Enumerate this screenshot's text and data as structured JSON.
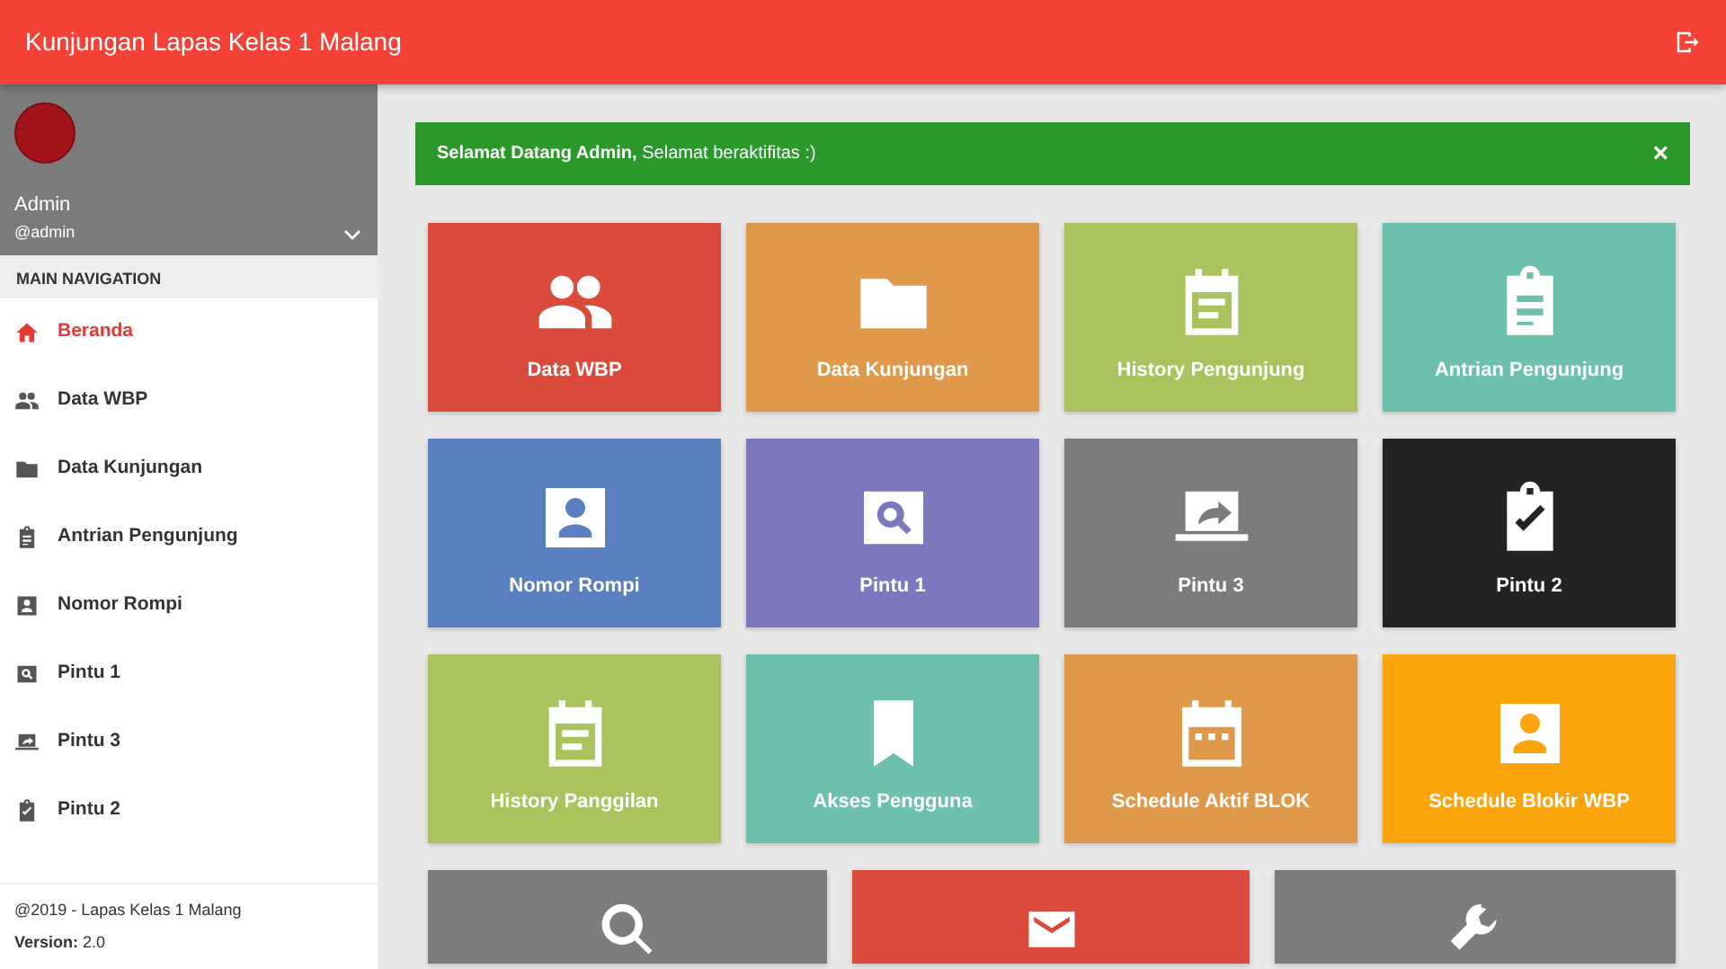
{
  "app_bar": {
    "title": "Kunjungan Lapas Kelas 1 Malang"
  },
  "user": {
    "name": "Admin",
    "handle": "@admin"
  },
  "sidebar": {
    "header": "MAIN NAVIGATION",
    "items": [
      {
        "label": "Beranda",
        "selected": true
      },
      {
        "label": "Data WBP",
        "selected": false
      },
      {
        "label": "Data Kunjungan",
        "selected": false
      },
      {
        "label": "Antrian Pengunjung",
        "selected": false
      },
      {
        "label": "Nomor Rompi",
        "selected": false
      },
      {
        "label": "Pintu 1",
        "selected": false
      },
      {
        "label": "Pintu 3",
        "selected": false
      },
      {
        "label": "Pintu 2",
        "selected": false
      }
    ],
    "copyright": "@2019 - Lapas Kelas 1 Malang",
    "version_label": "Version:",
    "version": "2.0"
  },
  "alert": {
    "bold": "Selamat Datang Admin,",
    "text": "Selamat beraktifitas :)",
    "close": "×"
  },
  "tiles": [
    {
      "label": "Data WBP",
      "color": "#da4b3c"
    },
    {
      "label": "Data Kunjungan",
      "color": "#e0994a"
    },
    {
      "label": "History Pengunjung",
      "color": "#aac35d"
    },
    {
      "label": "Antrian Pengunjung",
      "color": "#6dc0ae"
    },
    {
      "label": "Nomor Rompi",
      "color": "#5a80c1"
    },
    {
      "label": "Pintu 1",
      "color": "#7d77bd"
    },
    {
      "label": "Pintu 3",
      "color": "#7d7b7e"
    },
    {
      "label": "Pintu 2",
      "color": "#232325"
    },
    {
      "label": "History Panggilan",
      "color": "#aac35d"
    },
    {
      "label": "Akses Pengguna",
      "color": "#6dc0ae"
    },
    {
      "label": "Schedule Aktif BLOK",
      "color": "#e0994a"
    },
    {
      "label": "Schedule Blokir WBP",
      "color": "#fba40b"
    }
  ],
  "bottom_tiles": [
    {
      "color": "#7d7b7e"
    },
    {
      "color": "#da4b3c"
    },
    {
      "color": "#7d7b7e"
    }
  ]
}
